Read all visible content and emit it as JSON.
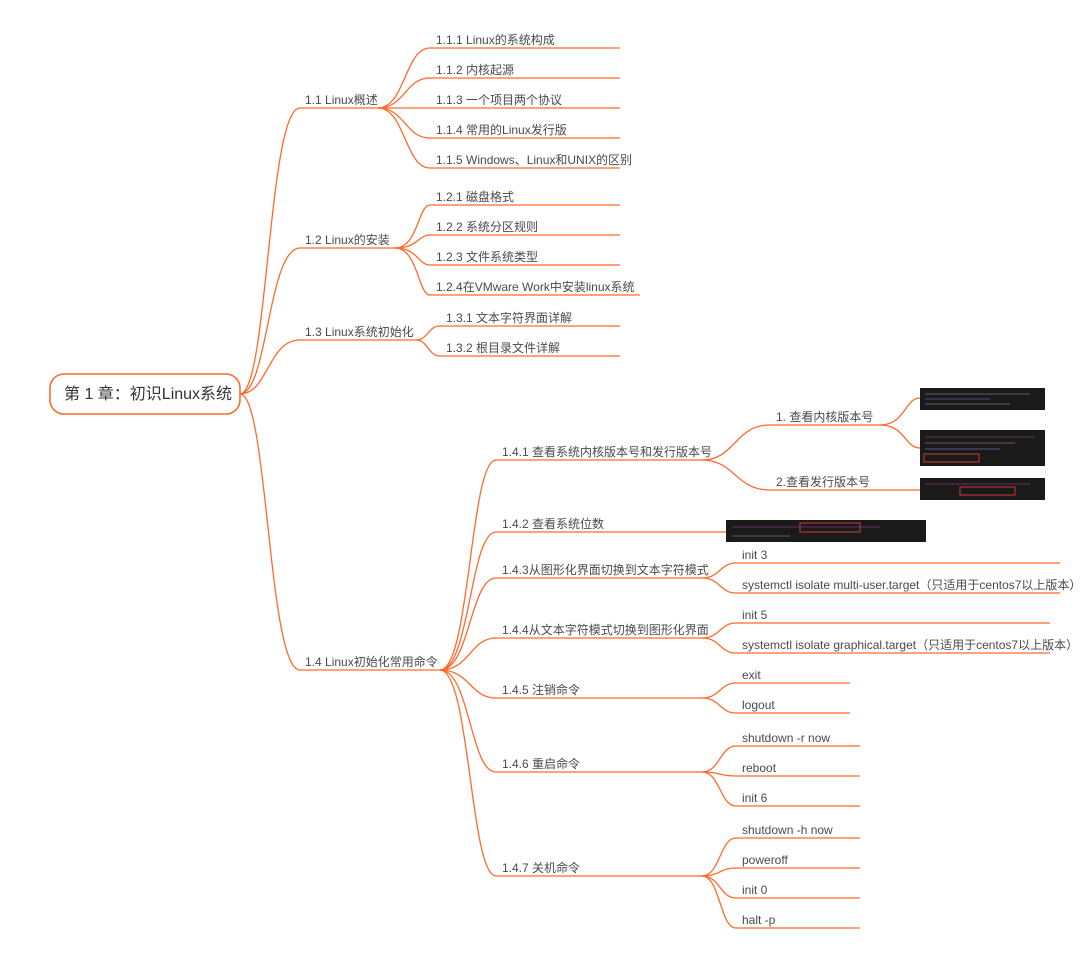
{
  "root": "第 1 章：初识Linux系统",
  "colors": {
    "accent": "#ff6a2b",
    "text": "#4a4a4a",
    "thumbBg": "#1a1a1a"
  },
  "tree": {
    "n1_1": {
      "label": "1.1 Linux概述",
      "children": {
        "n1_1_1": "1.1.1 Linux的系统构成",
        "n1_1_2": "1.1.2 内核起源",
        "n1_1_3": "1.1.3 一个项目两个协议",
        "n1_1_4": "1.1.4 常用的Linux发行版",
        "n1_1_5": "1.1.5 Windows、Linux和UNIX的区别"
      }
    },
    "n1_2": {
      "label": "1.2 Linux的安装",
      "children": {
        "n1_2_1": "1.2.1 磁盘格式",
        "n1_2_2": "1.2.2 系统分区规则",
        "n1_2_3": "1.2.3 文件系统类型",
        "n1_2_4": "1.2.4在VMware Work中安装linux系统"
      }
    },
    "n1_3": {
      "label": "1.3 Linux系统初始化",
      "children": {
        "n1_3_1": "1.3.1 文本字符界面详解",
        "n1_3_2": "1.3.2 根目录文件详解"
      }
    },
    "n1_4": {
      "label": "1.4 Linux初始化常用命令",
      "children": {
        "n1_4_1": {
          "label": "1.4.1 查看系统内核版本号和发行版本号",
          "children": {
            "a": "1. 查看内核版本号",
            "b": "2.查看发行版本号"
          }
        },
        "n1_4_2": {
          "label": "1.4.2 查看系统位数"
        },
        "n1_4_3": {
          "label": "1.4.3从图形化界面切换到文本字符模式",
          "children": {
            "a": "init  3",
            "b": "systemctl  isolate multi-user.target（只适用于centos7以上版本）"
          }
        },
        "n1_4_4": {
          "label": "1.4.4从文本字符模式切换到图形化界面",
          "children": {
            "a": "init 5",
            "b": "systemctl  isolate graphical.target（只适用于centos7以上版本）"
          }
        },
        "n1_4_5": {
          "label": "1.4.5 注销命令",
          "children": {
            "a": "exit",
            "b": "logout"
          }
        },
        "n1_4_6": {
          "label": "1.4.6 重启命令",
          "children": {
            "a": "shutdown  -r  now",
            "b": "reboot",
            "c": "init  6"
          }
        },
        "n1_4_7": {
          "label": "1.4.7 关机命令",
          "children": {
            "a": "shutdown -h  now",
            "b": "poweroff",
            "c": "init 0",
            "d": "halt -p"
          }
        }
      }
    }
  }
}
